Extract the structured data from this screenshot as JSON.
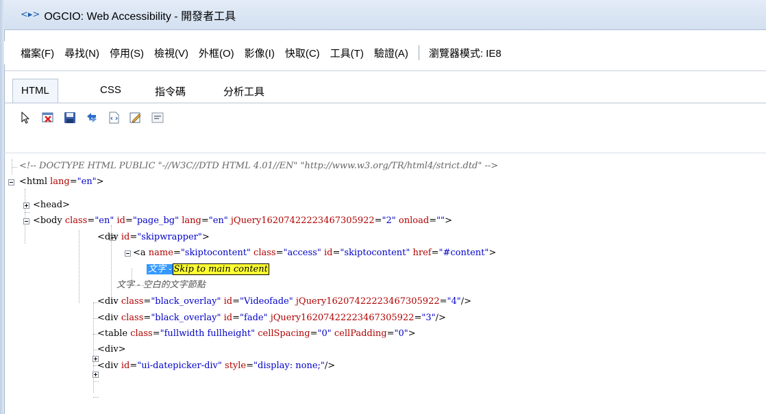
{
  "window": {
    "title": "OGCIO: Web Accessibility - 開發者工具",
    "icon": "dev-tools-icon"
  },
  "menu": {
    "items": [
      "檔案(F)",
      "尋找(N)",
      "停用(S)",
      "檢視(V)",
      "外框(O)",
      "影像(I)",
      "快取(C)",
      "工具(T)",
      "驗證(A)"
    ],
    "browser_mode": "瀏覽器模式: IE8"
  },
  "tabs": [
    {
      "label": "HTML",
      "active": true
    },
    {
      "label": "CSS",
      "active": false
    },
    {
      "label": "指令碼",
      "active": false
    },
    {
      "label": "分析工具",
      "active": false
    }
  ],
  "toolbar": {
    "icons": [
      "select-element-icon",
      "clear-browser-cache-icon",
      "save-icon",
      "refresh-icon",
      "view-source-icon",
      "edit-icon",
      "word-wrap-icon"
    ]
  },
  "tree": {
    "doctype": "<!-- DOCTYPE HTML PUBLIC \"-//W3C//DTD HTML 4.01//EN\" \"http://www.w3.org/TR/html4/strict.dtd\" -->",
    "html_open": "<html",
    "attr_lang": "lang",
    "val_en": "\"en\"",
    "close_gt": ">",
    "head_tag": "<head>",
    "body_open": "<body",
    "attr_class": "class",
    "attr_id": "id",
    "val_page_bg": "\"page_bg\"",
    "attr_jquery": "jQuery16207422223467305922",
    "val_2": "\"2\"",
    "attr_onload": "onload",
    "val_empty": "\"\"",
    "div_open": "<div",
    "val_skipwrapper": "\"skipwrapper\"",
    "a_open": "<a",
    "attr_name": "name",
    "val_skiptocontent": "\"skiptocontent\"",
    "val_access": "\"access\"",
    "attr_href": "href",
    "val_content_href": "\"#content\"",
    "text_label_selected": "文字 -",
    "text_value_selected": "Skip to main content",
    "text_whitespace": "文字 - 空白的文字節點",
    "val_black_overlay": "\"black_overlay\"",
    "val_videofade": "\"Videofade\"",
    "val_4": "\"4\"",
    "self_close": "/>",
    "val_fade": "\"fade\"",
    "val_3": "\"3\"",
    "table_open": "<table",
    "val_fullwidth": "\"fullwidth fullheight\"",
    "attr_cellspacing": "cellSpacing",
    "val_0": "\"0\"",
    "attr_cellpadding": "cellPadding",
    "div_tag": "<div>",
    "val_datepicker": "\"ui-datepicker-div\"",
    "attr_style": "style",
    "val_display_none": "\"display: none;\""
  }
}
